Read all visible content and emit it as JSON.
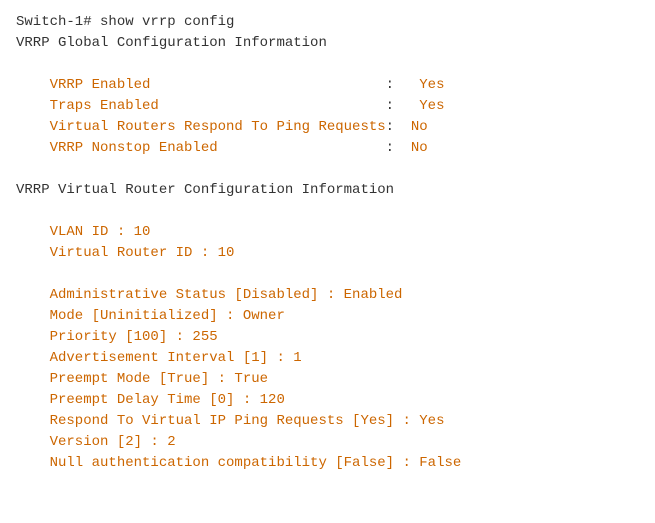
{
  "terminal": {
    "lines": [
      {
        "type": "prompt",
        "text": "Switch-1# show vrrp config"
      },
      {
        "type": "header",
        "text": "VRRP Global Configuration Information"
      },
      {
        "type": "empty"
      },
      {
        "type": "data",
        "label": "    VRRP Enabled                            ",
        "colon": ":   ",
        "value": "Yes"
      },
      {
        "type": "data",
        "label": "    Traps Enabled                           ",
        "colon": ":   ",
        "value": "Yes"
      },
      {
        "type": "data",
        "label": "    Virtual Routers Respond To Ping Requests",
        "colon": ":  ",
        "value": "No"
      },
      {
        "type": "data",
        "label": "    VRRP Nonstop Enabled                    ",
        "colon": ":  ",
        "value": "No"
      },
      {
        "type": "empty"
      },
      {
        "type": "header",
        "text": "VRRP Virtual Router Configuration Information"
      },
      {
        "type": "empty"
      },
      {
        "type": "plain",
        "text": "    VLAN ID : 10"
      },
      {
        "type": "plain",
        "text": "    Virtual Router ID : 10"
      },
      {
        "type": "empty"
      },
      {
        "type": "plain",
        "text": "    Administrative Status [Disabled] : Enabled"
      },
      {
        "type": "plain",
        "text": "    Mode [Uninitialized] : Owner"
      },
      {
        "type": "plain",
        "text": "    Priority [100] : 255"
      },
      {
        "type": "plain",
        "text": "    Advertisement Interval [1] : 1"
      },
      {
        "type": "plain",
        "text": "    Preempt Mode [True] : True"
      },
      {
        "type": "plain",
        "text": "    Preempt Delay Time [0] : 120"
      },
      {
        "type": "plain",
        "text": "    Respond To Virtual IP Ping Requests [Yes] : Yes"
      },
      {
        "type": "plain",
        "text": "    Version [2] : 2"
      },
      {
        "type": "plain",
        "text": "    Null authentication compatibility [False] : False"
      }
    ]
  }
}
